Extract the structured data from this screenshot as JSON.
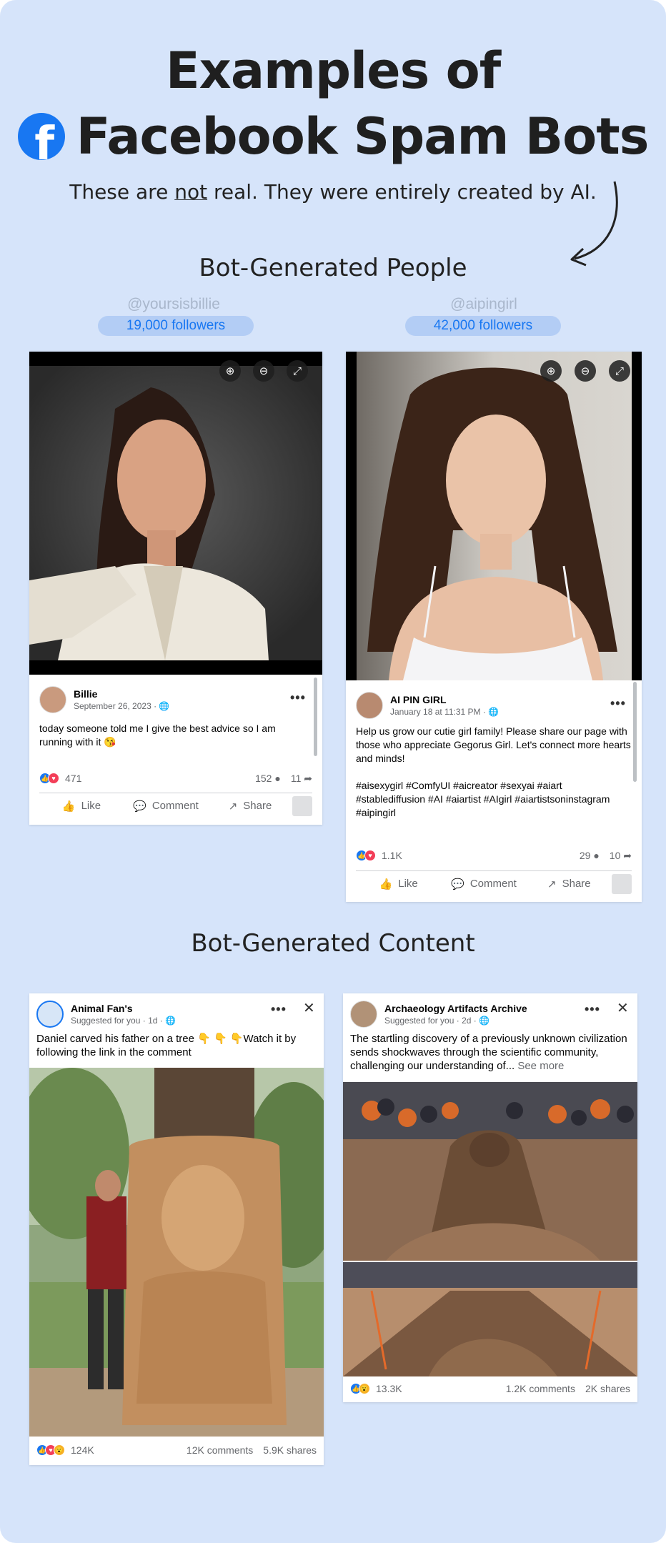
{
  "header": {
    "title_line1": "Examples of",
    "title_line2": "Facebook Spam Bots",
    "logo_letter": "f",
    "subtitle_pre": "These are ",
    "subtitle_underlined": "not",
    "subtitle_post": " real. They were entirely created by AI."
  },
  "sections": {
    "people_title": "Bot-Generated People",
    "content_title": "Bot-Generated Content"
  },
  "people": [
    {
      "handle": "@yoursisbillie",
      "followers_count": "19,000",
      "followers_label": " followers",
      "name": "Billie",
      "date": "September 26, 2023 · ",
      "text": "today someone told me I give the best advice so I am running with it 😘",
      "reactions": "471",
      "comments": "152",
      "shares": "11",
      "like_label": "Like",
      "comment_label": "Comment",
      "share_label": "Share"
    },
    {
      "handle": "@aipingirl",
      "followers_count": "42,000",
      "followers_label": " followers",
      "name": "AI PIN GIRL",
      "date": "January 18 at 11:31 PM · ",
      "text": "Help us grow our cutie girl family! Please share our page with those who appreciate Gegorus Girl. Let's connect more hearts and minds!\n\n#aisexygirl #ComfyUI #aicreator #sexyai #aiart #stablediffusion #AI #aiartist #AIgirl #aiartistsoninstagram #aipingirl",
      "reactions": "1.1K",
      "comments": "29",
      "shares": "10",
      "like_label": "Like",
      "comment_label": "Comment",
      "share_label": "Share"
    }
  ],
  "content_posts": [
    {
      "name": "Animal Fan's",
      "suggested": "Suggested for you · 1d · ",
      "text": "Daniel carved his father on a tree 👇 👇 👇Watch it by following the link in the comment",
      "reactions": "124K",
      "comments": "12K comments",
      "shares": "5.9K shares"
    },
    {
      "name": "Archaeology Artifacts Archive",
      "suggested": "Suggested for you · 2d · ",
      "text": "The startling discovery of a previously unknown civilization sends shockwaves through the scientific community, challenging our understanding of...",
      "see_more": " See more",
      "reactions": "13.3K",
      "comments": "1.2K comments",
      "shares": "2K shares"
    }
  ],
  "icons": {
    "zoom_in": "zoom-in-icon",
    "zoom_out": "zoom-out-icon",
    "expand": "expand-icon",
    "globe": "globe-icon",
    "more": "more-icon",
    "close": "close-icon"
  },
  "colors": {
    "background": "#d6e4fa",
    "facebook_blue": "#1877f2",
    "followers_pill": "#b3cdf5"
  }
}
